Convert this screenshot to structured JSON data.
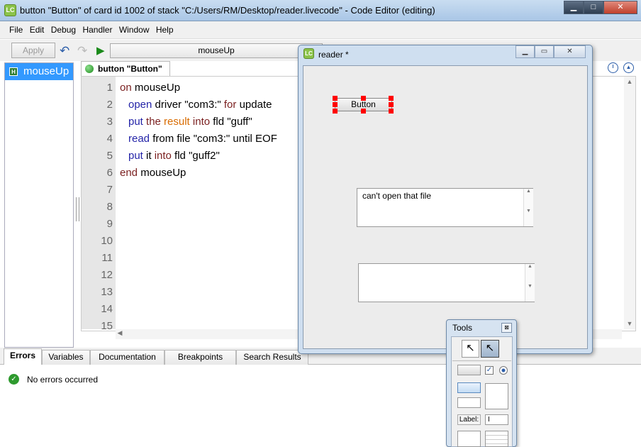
{
  "window": {
    "title": "button \"Button\" of card id 1002 of stack \"C:/Users/RM/Desktop/reader.livecode\" - Code Editor (editing)",
    "logo": "LC"
  },
  "menu": [
    "File",
    "Edit",
    "Debug",
    "Handler",
    "Window",
    "Help"
  ],
  "toolbar": {
    "apply_label": "Apply",
    "handler_name": "mouseUp"
  },
  "handlers": [
    {
      "badge": "H",
      "name": "mouseUp"
    }
  ],
  "editor": {
    "tab_label": "button \"Button\"",
    "line_numbers": [
      "1",
      "2",
      "3",
      "4",
      "5",
      "6",
      "7",
      "8",
      "9",
      "10",
      "11",
      "12",
      "13",
      "14",
      "15"
    ],
    "code": {
      "l1_kw": "on",
      "l1_name": " mouseUp",
      "l2_a": "open",
      "l2_b": " driver \"com3:\" ",
      "l2_c": "for",
      "l2_d": " update",
      "l3_a": "put",
      "l3_b": " the ",
      "l3_c": "result",
      "l3_d": " into",
      "l3_e": " fld \"guff\"",
      "l4_a": "read",
      "l4_b": " from file \"com3:\" until EOF",
      "l5_a": "put",
      "l5_b": " it ",
      "l5_c": "into",
      "l5_d": " fld \"guff2\"",
      "l6_kw": "end",
      "l6_name": " mouseUp"
    }
  },
  "bottom_tabs": [
    "Errors",
    "Variables",
    "Documentation",
    "Breakpoints",
    "Search Results"
  ],
  "errors": {
    "message": "No errors occurred"
  },
  "stack_window": {
    "logo": "LC",
    "title": "reader *",
    "button_label": "Button",
    "field_guff_text": "can't open that file",
    "field_guff2_text": ""
  },
  "tools_palette": {
    "title": "Tools",
    "close": "⊠",
    "label_tool_text": "Label:",
    "text_cursor": "I"
  },
  "colors": {
    "selection": "#3399ff",
    "keyword": "#7a1f1f",
    "command": "#2424a8",
    "function": "#d86b00",
    "handle": "#ff0000"
  }
}
